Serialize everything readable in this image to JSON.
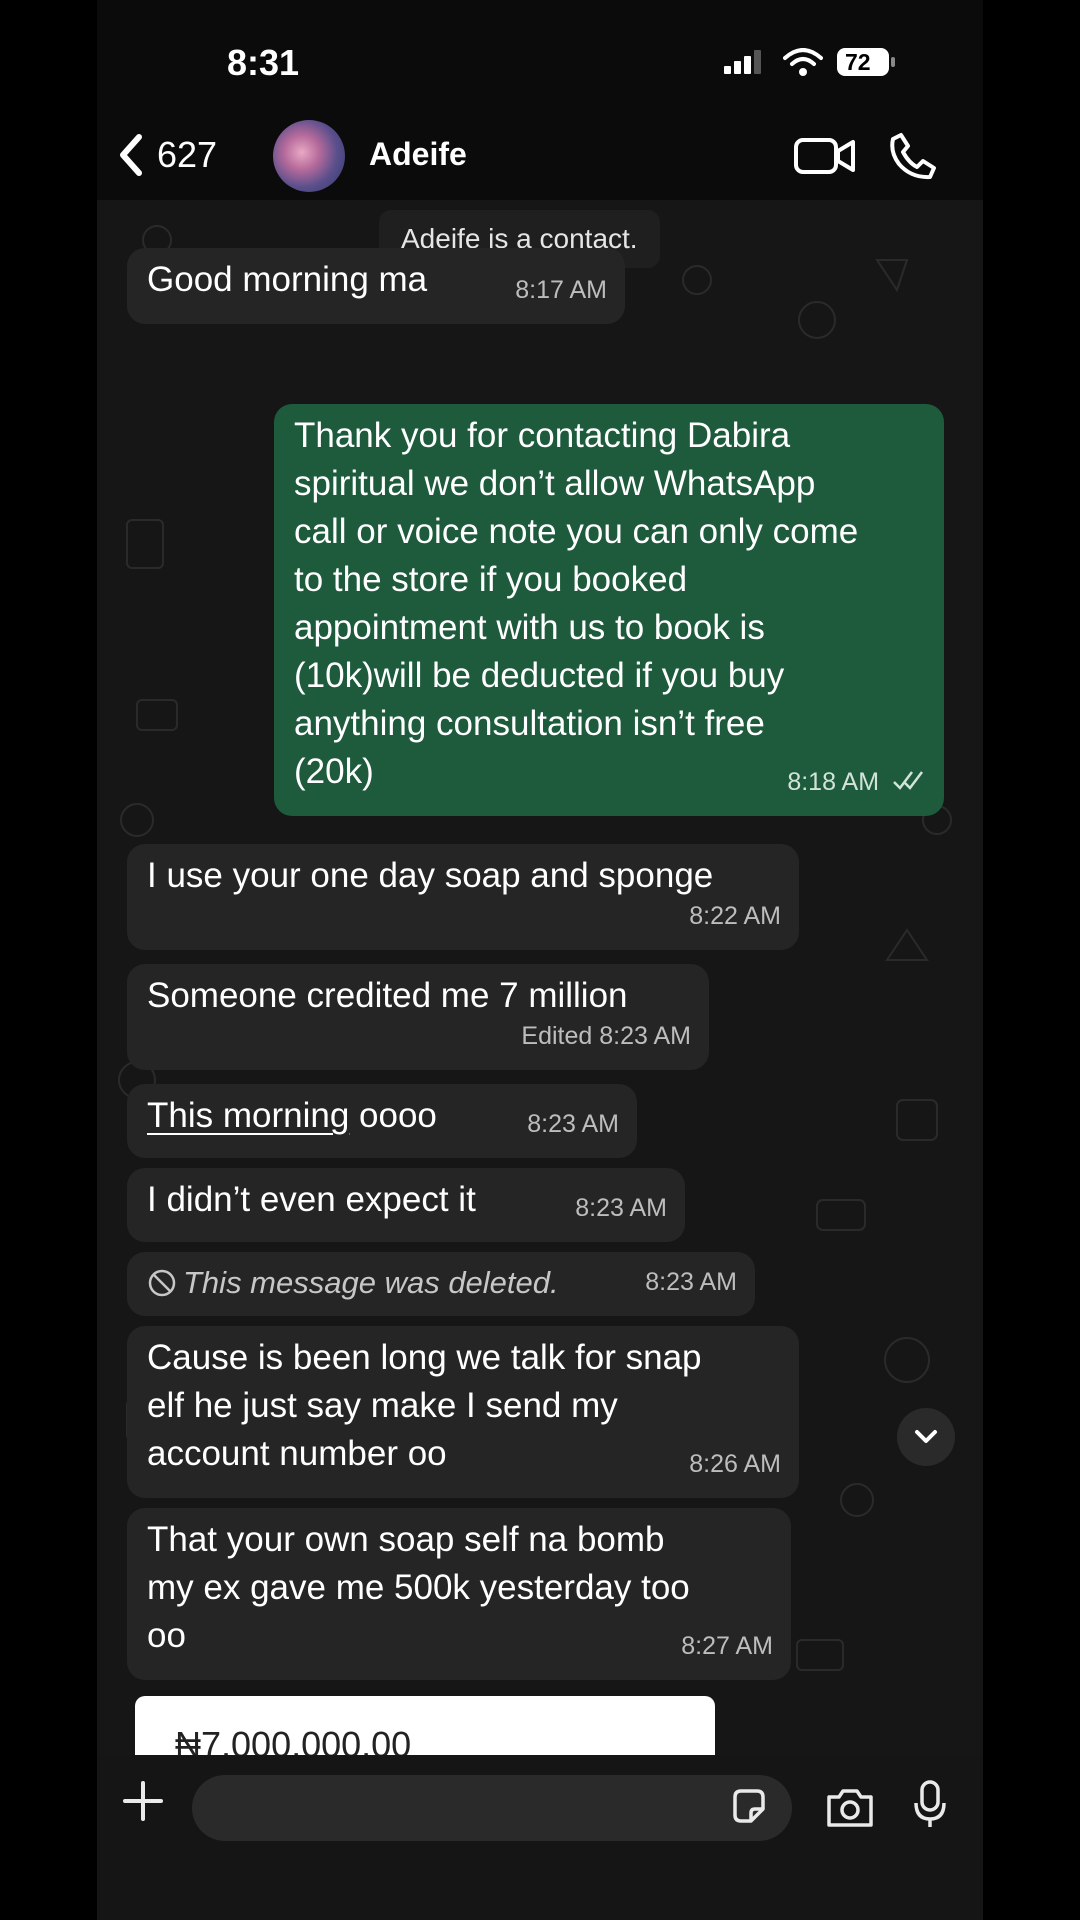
{
  "status_bar": {
    "time": "8:31",
    "battery": "72"
  },
  "header": {
    "back_count": "627",
    "contact_name": "Adeife"
  },
  "chat": {
    "system_note": "Adeife is a contact.",
    "messages": [
      {
        "direction": "in",
        "text": "Good morning ma",
        "time": "8:17 AM"
      },
      {
        "direction": "out",
        "lines": [
          "Thank you for contacting Dabira",
          "spiritual we don’t allow WhatsApp",
          "call or voice note you can only come",
          "to the store if you booked",
          "appointment with us to book is",
          "(10k)will be deducted if you buy",
          "anything consultation isn’t free",
          "(20k)"
        ],
        "time": "8:18 AM"
      },
      {
        "direction": "in",
        "text": "I use your one day soap and sponge",
        "time": "8:22 AM"
      },
      {
        "direction": "in",
        "text": "Someone credited me 7 million",
        "edited": "Edited",
        "time": "8:23 AM"
      },
      {
        "direction": "in",
        "text_underlined": "This morning",
        "text_rest": " oooo",
        "time": "8:23 AM"
      },
      {
        "direction": "in",
        "text": "I didn’t even expect it",
        "time": "8:23 AM"
      },
      {
        "direction": "in",
        "deleted": "This message was deleted.",
        "time": "8:23 AM"
      },
      {
        "direction": "in",
        "lines": [
          "Cause is been long we talk for snap",
          "elf he just say make I send my",
          "account number oo"
        ],
        "time": "8:26 AM"
      },
      {
        "direction": "in",
        "lines": [
          "That your own soap self na bomb",
          "my ex gave me 500k yesterday too",
          "oo"
        ],
        "time": "8:27 AM"
      }
    ],
    "preview_amount": "₦7,000,000.00"
  },
  "colors": {
    "outgoing_bubble": "#1d5b3c",
    "incoming_bubble": "#252525",
    "background": "#161616"
  }
}
